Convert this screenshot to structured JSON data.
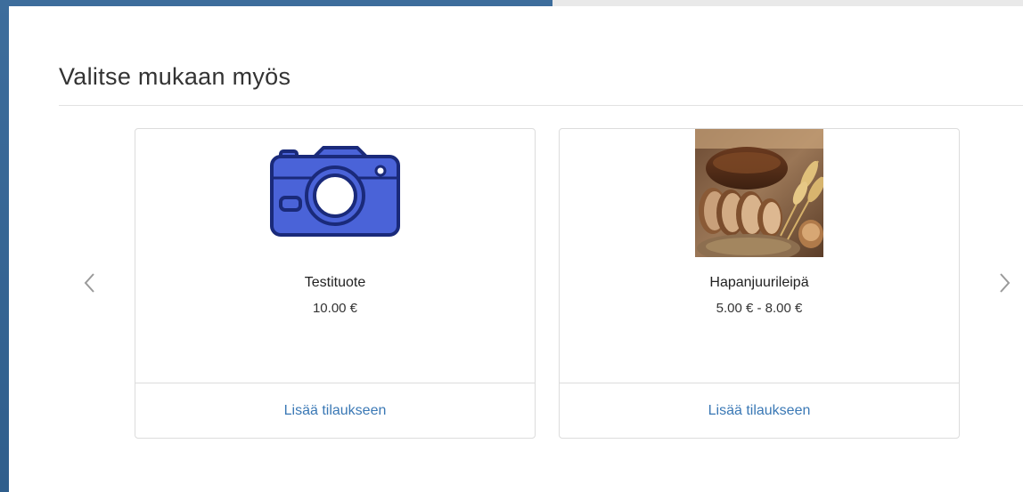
{
  "section": {
    "title": "Valitse mukaan myös"
  },
  "products": [
    {
      "name": "Testituote",
      "price": "10.00 €",
      "image_icon": "camera-icon",
      "add_label": "Lisää tilaukseen"
    },
    {
      "name": "Hapanjuurileipä",
      "price": "5.00 € - 8.00 €",
      "image_icon": "bread-photo",
      "add_label": "Lisää tilaukseen"
    }
  ],
  "carousel": {
    "prev_icon": "chevron-left-icon",
    "next_icon": "chevron-right-icon"
  },
  "colors": {
    "link": "#3a78b5",
    "camera_fill": "#4a63d8",
    "camera_stroke": "#1a2a7a",
    "background_frame": "#2f5e8c"
  }
}
